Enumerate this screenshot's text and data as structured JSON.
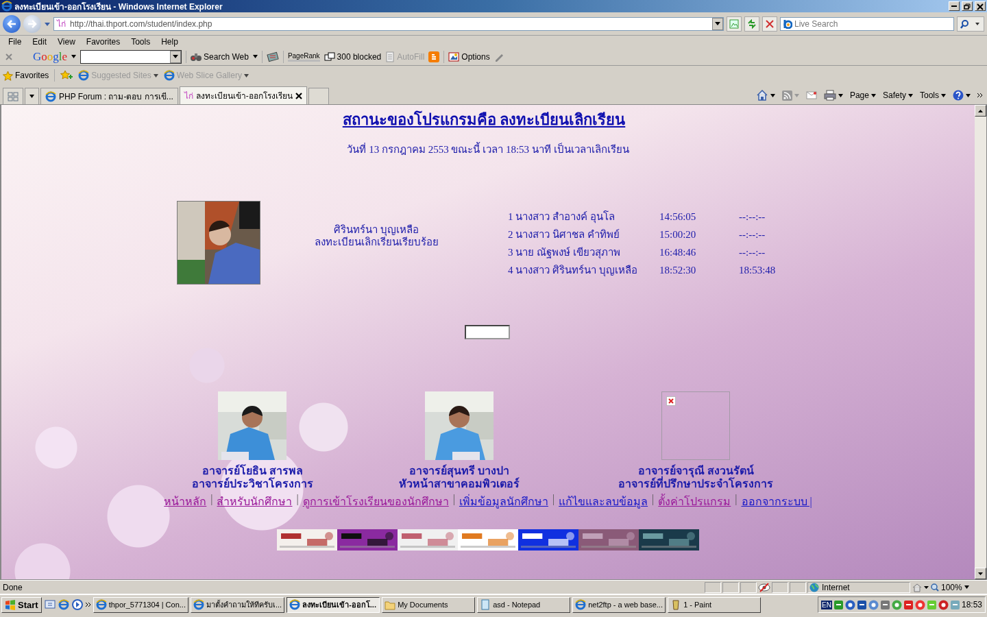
{
  "window": {
    "title": "ลงทะเบียนเข้า-ออกโรงเรียน - Windows Internet Explorer"
  },
  "address_bar": {
    "site_icon": "ไก่",
    "url": "http://thai.thport.com/student/index.php",
    "search_placeholder": "Live Search"
  },
  "menu": [
    "File",
    "Edit",
    "View",
    "Favorites",
    "Tools",
    "Help"
  ],
  "google_toolbar": {
    "logo": "Google",
    "search_label": "Search Web",
    "pagerank": "PageRank",
    "blocked": "300 blocked",
    "autofill": "AutoFill",
    "options": "Options"
  },
  "favorites_bar": {
    "favorites": "Favorites",
    "items": [
      "Suggested Sites",
      "Web Slice Gallery"
    ]
  },
  "tabs": [
    {
      "label": "PHP Forum : ถาม-ตอบ การเขี...",
      "selected": false
    },
    {
      "label": "ลงทะเบียนเข้า-ออกโรงเรียน",
      "icon_text": "ไก่",
      "selected": true
    }
  ],
  "command_bar": [
    "Page",
    "Safety",
    "Tools"
  ],
  "page": {
    "heading": "สถานะของโปรแกรมคือ ลงทะเบียนเลิกเรียน",
    "date_line": "วันที่ 13 กรกฎาคม 2553 ขณะนี้ เวลา 18:53 นาที เป็นเวลาเลิกเรียน",
    "student": {
      "name": "ศิรินทร์นา บุญเหลือ",
      "status": "ลงทะเบียนเลิกเรียนเรียบร้อย"
    },
    "log": [
      {
        "entry": "1 นางสาว สำอางค์ อุนโล",
        "time_in": "14:56:05",
        "time_out": "--:--:--"
      },
      {
        "entry": "2 นางสาว นิศาชล คำทิพย์",
        "time_in": "15:00:20",
        "time_out": "--:--:--"
      },
      {
        "entry": "3 นาย ณัฐพงษ์ เขียวสุภาพ",
        "time_in": "16:48:46",
        "time_out": "--:--:--"
      },
      {
        "entry": "4 นางสาว ศิรินทร์นา บุญเหลือ",
        "time_in": "18:52:30",
        "time_out": "18:53:48"
      }
    ],
    "teachers": [
      {
        "name": "อาจารย์โยธิน สารพล",
        "role": "อาจารย์ประวิชาโครงการ",
        "kind": "picture"
      },
      {
        "name": "อาจารย์สุนทรี บางปา",
        "role": "หัวหน้าสาขาคอมพิวเตอร์",
        "kind": "picture"
      },
      {
        "name": "อาจารย์จารุณี สงวนรัตน์",
        "role": "อาจารย์ที่ปรึกษาประจำโครงการ",
        "kind": "broken"
      }
    ],
    "link_separator": "|",
    "links": [
      {
        "label": "หน้าหลัก",
        "visited": true
      },
      {
        "label": "สำหรับนักศึกษา",
        "visited": true
      },
      {
        "label": "ดูการเข้าโรงเรียนของนักศึกษา",
        "visited": true
      },
      {
        "label": "เพิ่มข้อมูลนักศึกษา",
        "visited": false
      },
      {
        "label": "แก้ไขและลบข้อมูล",
        "visited": false
      },
      {
        "label": "ตั้งค่าโปรแกรม",
        "visited": true
      },
      {
        "label": "ออกจากระบบ |",
        "visited": false
      }
    ]
  },
  "status_bar": {
    "text": "Done",
    "zone": "Internet",
    "zoom": "100%"
  },
  "taskbar": {
    "start": "Start",
    "tasks": [
      {
        "label": "thpor_5771304 | Con...",
        "selected": false
      },
      {
        "label": "มาตั้งคำถามให้ทีครับเ...",
        "selected": false
      },
      {
        "label": "ลงทะเบียนเข้า-ออกโ...",
        "selected": true
      },
      {
        "label": "My Documents",
        "selected": false
      },
      {
        "label": "asd - Notepad",
        "selected": false
      },
      {
        "label": "net2ftp - a web base...",
        "selected": false
      },
      {
        "label": "1 - Paint",
        "selected": false
      }
    ],
    "language": "EN",
    "clock": "18:53"
  }
}
